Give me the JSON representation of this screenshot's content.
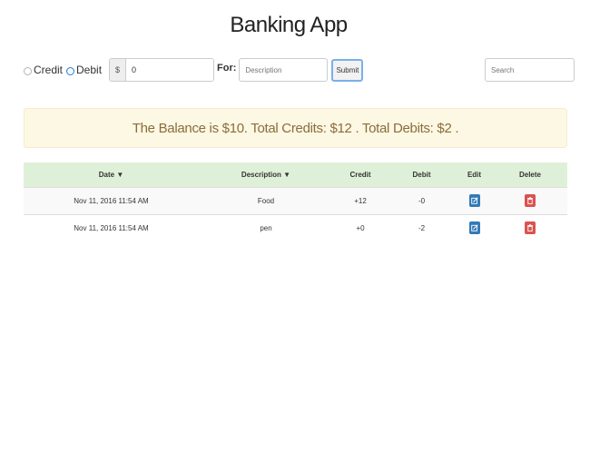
{
  "app": {
    "title": "Banking App"
  },
  "form": {
    "credit_label": "Credit",
    "debit_label": "Debit",
    "selected_type": "Debit",
    "currency_symbol": "$",
    "amount_value": "0",
    "for_label": "For:",
    "description_placeholder": "Description",
    "submit_label": "Submit"
  },
  "search": {
    "placeholder": "Search"
  },
  "summary": {
    "text": "The Balance is $10. Total Credits: $12 . Total Debits: $2 ."
  },
  "table": {
    "headers": {
      "date": "Date ▼",
      "description": "Description ▼",
      "credit": "Credit",
      "debit": "Debit",
      "edit": "Edit",
      "delete": "Delete"
    },
    "rows": [
      {
        "date": "Nov 11, 2016 11:54 AM",
        "description": "Food",
        "credit": "+12",
        "debit": "-0"
      },
      {
        "date": "Nov 11, 2016 11:54 AM",
        "description": "pen",
        "credit": "+0",
        "debit": "-2"
      }
    ]
  },
  "colors": {
    "alert_bg": "#fcf8e3",
    "alert_text": "#8a6d3b",
    "header_bg": "#dff0d8",
    "edit_button": "#337ab7",
    "delete_button": "#d9534f",
    "radio_checked": "#3b8ff0"
  },
  "icons": {
    "edit": "edit-icon",
    "delete": "trash-icon"
  }
}
